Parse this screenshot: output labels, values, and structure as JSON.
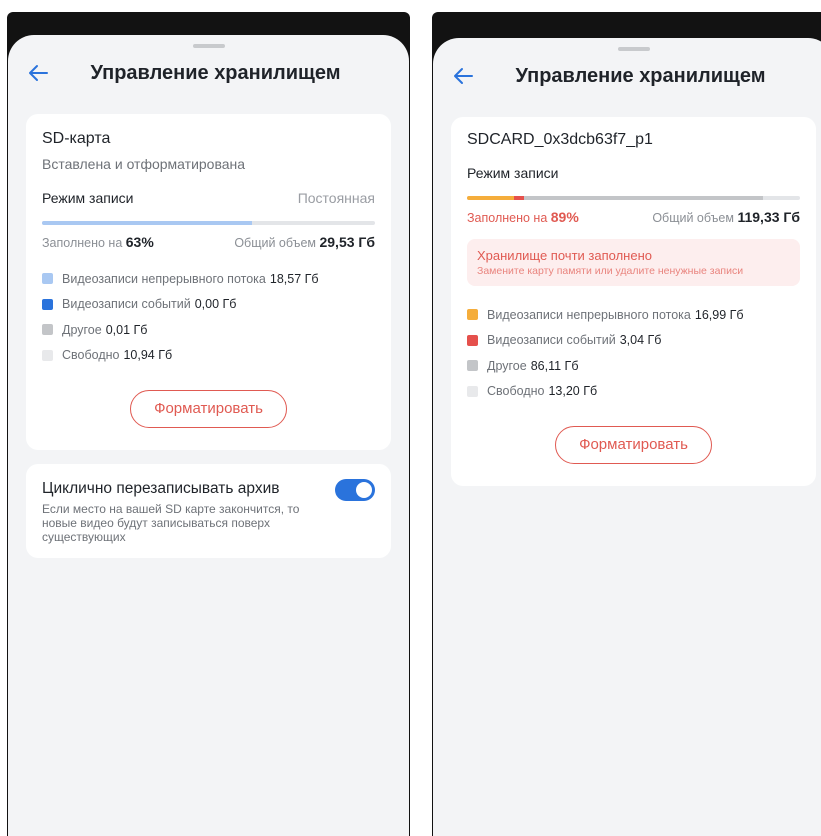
{
  "left": {
    "header": {
      "title": "Управление хранилищем"
    },
    "card": {
      "title": "SD-карта",
      "subtitle": "Вставлена и отформатирована",
      "mode_label": "Режим записи",
      "mode_value": "Постоянная",
      "progress_fraction": 0.63,
      "fill_prefix": "Заполнено на",
      "fill_value": "63%",
      "total_prefix": "Общий объем",
      "total_value": "29,53 Гб",
      "legend": [
        {
          "label": "Видеозаписи непрерывного потока",
          "value": "18,57 Гб",
          "color": "#a9c8f2"
        },
        {
          "label": "Видеозаписи событий",
          "value": "0,00 Гб",
          "color": "#2a73dc"
        },
        {
          "label": "Другое",
          "value": "0,01 Гб",
          "color": "#c3c5c8"
        },
        {
          "label": "Свободно",
          "value": "10,94 Гб",
          "color": "#e8e9eb"
        }
      ],
      "format_button": "Форматировать"
    },
    "cycle": {
      "title": "Циклично перезаписывать архив",
      "description": "Если место на вашей SD карте закончится, то новые видео будут записываться поверх существующих",
      "toggle_on": true
    }
  },
  "right": {
    "header": {
      "title": "Управление хранилищем"
    },
    "card": {
      "title": "SDCARD_0x3dcb63f7_p1",
      "mode_label": "Режим записи",
      "progress": {
        "continuous": 0.14,
        "events": 0.03,
        "other": 0.72
      },
      "fill_prefix": "Заполнено на",
      "fill_value": "89%",
      "total_prefix": "Общий объем",
      "total_value": "119,33 Гб",
      "warning_title": "Хранилище почти заполнено",
      "warning_sub": "Замените карту памяти или удалите ненужные записи",
      "legend": [
        {
          "label": "Видеозаписи непрерывного потока",
          "value": "16,99 Гб",
          "color": "#f5ad3b"
        },
        {
          "label": "Видеозаписи событий",
          "value": "3,04 Гб",
          "color": "#e5504c"
        },
        {
          "label": "Другое",
          "value": "86,11 Гб",
          "color": "#c3c5c8"
        },
        {
          "label": "Свободно",
          "value": "13,20 Гб",
          "color": "#e8e9eb"
        }
      ],
      "format_button": "Форматировать"
    }
  }
}
